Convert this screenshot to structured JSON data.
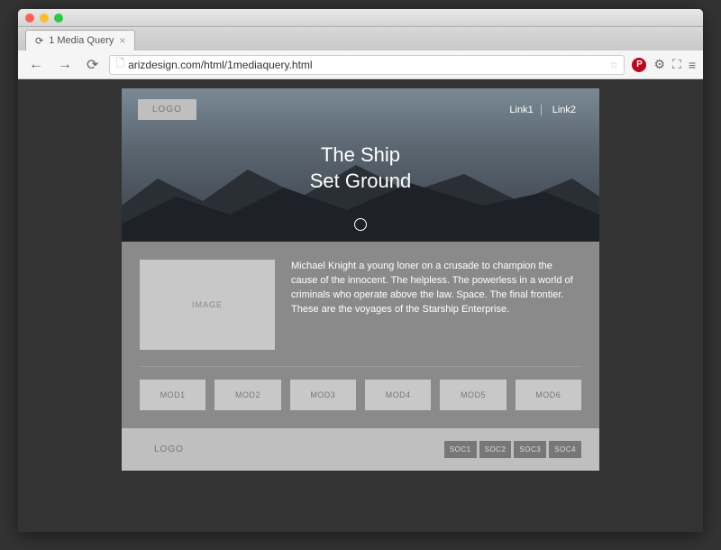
{
  "browser": {
    "tab_title": "1 Media Query",
    "url": "arizdesign.com/html/1mediaquery.html"
  },
  "hero": {
    "logo": "LOGO",
    "link1": "Link1",
    "link2": "Link2",
    "title_line1": "The Ship",
    "title_line2": "Set Ground"
  },
  "content": {
    "image_label": "IMAGE",
    "paragraph": "Michael Knight a young loner on a crusade to champion the cause of the innocent. The helpless. The powerless in a world of criminals who operate above the law. Space. The final frontier. These are the voyages of the Starship Enterprise.",
    "mods": [
      "MOD1",
      "MOD2",
      "MOD3",
      "MOD4",
      "MOD5",
      "MOD6"
    ]
  },
  "footer": {
    "logo": "LOGO",
    "socials": [
      "SOC1",
      "SOC2",
      "SOC3",
      "SOC4"
    ]
  }
}
